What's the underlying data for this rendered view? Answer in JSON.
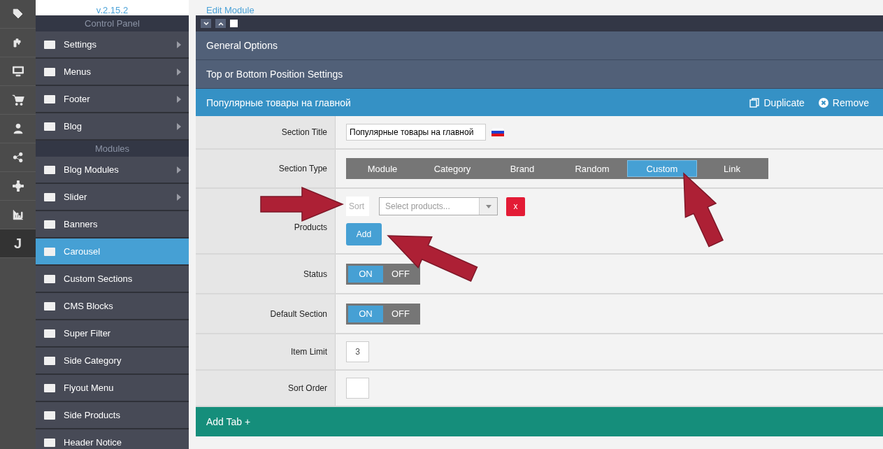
{
  "rail": [
    {
      "selected": false
    },
    {
      "selected": false
    },
    {
      "selected": false
    },
    {
      "selected": false
    },
    {
      "selected": false
    },
    {
      "selected": false
    },
    {
      "selected": false
    },
    {
      "selected": false
    },
    {
      "selected": true,
      "label": "J"
    }
  ],
  "brand": {
    "version": "v.2.15.2"
  },
  "nav": [
    {
      "kind": "heading",
      "label": "Control Panel"
    },
    {
      "kind": "item",
      "label": "Settings",
      "submenu": true,
      "selected": false
    },
    {
      "kind": "item",
      "label": "Menus",
      "submenu": true,
      "selected": false
    },
    {
      "kind": "item",
      "label": "Footer",
      "submenu": true,
      "selected": false
    },
    {
      "kind": "item",
      "label": "Blog",
      "submenu": true,
      "selected": false
    },
    {
      "kind": "heading",
      "label": "Modules"
    },
    {
      "kind": "item",
      "label": "Blog Modules",
      "submenu": true,
      "selected": false
    },
    {
      "kind": "item",
      "label": "Slider",
      "submenu": true,
      "selected": false
    },
    {
      "kind": "item",
      "label": "Banners",
      "submenu": false,
      "selected": false
    },
    {
      "kind": "item",
      "label": "Carousel",
      "submenu": false,
      "selected": true
    },
    {
      "kind": "item",
      "label": "Custom Sections",
      "submenu": false,
      "selected": false
    },
    {
      "kind": "item",
      "label": "CMS Blocks",
      "submenu": false,
      "selected": false
    },
    {
      "kind": "item",
      "label": "Super Filter",
      "submenu": false,
      "selected": false
    },
    {
      "kind": "item",
      "label": "Side Category",
      "submenu": false,
      "selected": false
    },
    {
      "kind": "item",
      "label": "Flyout Menu",
      "submenu": false,
      "selected": false
    },
    {
      "kind": "item",
      "label": "Side Products",
      "submenu": false,
      "selected": false
    },
    {
      "kind": "item",
      "label": "Header Notice",
      "submenu": false,
      "selected": false
    }
  ],
  "breadcrumb": "Edit Module",
  "select_all": {
    "checked": false
  },
  "panels": [
    {
      "title": "General Options"
    },
    {
      "title": "Top or Bottom Position Settings"
    }
  ],
  "section": {
    "title": "Популярные товары на главной",
    "actions": [
      {
        "label": "Duplicate",
        "kind": "duplicate"
      },
      {
        "label": "Remove",
        "kind": "remove"
      }
    ]
  },
  "rows": [
    {
      "kind": "text",
      "label": "Section Title",
      "value": "Популярные товары на главной"
    },
    {
      "kind": "segmented",
      "label": "Section Type",
      "options": [
        {
          "label": "Module",
          "selected": false
        },
        {
          "label": "Category",
          "selected": false
        },
        {
          "label": "Brand",
          "selected": false
        },
        {
          "label": "Random",
          "selected": false
        },
        {
          "label": "Custom",
          "selected": true
        },
        {
          "label": "Link",
          "selected": false
        }
      ]
    },
    {
      "kind": "products",
      "label": "Products",
      "sort_placeholder": "Sort",
      "select_placeholder": "Select products...",
      "remove": "x",
      "add": "Add"
    },
    {
      "kind": "toggle",
      "label": "Status",
      "on": true,
      "on_label": "ON",
      "off_label": "OFF"
    },
    {
      "kind": "toggle",
      "label": "Default Section",
      "on": true,
      "on_label": "ON",
      "off_label": "OFF"
    },
    {
      "kind": "number",
      "label": "Item Limit",
      "value": "3"
    },
    {
      "kind": "number",
      "label": "Sort Order"
    }
  ],
  "add_tab": "Add Tab +"
}
